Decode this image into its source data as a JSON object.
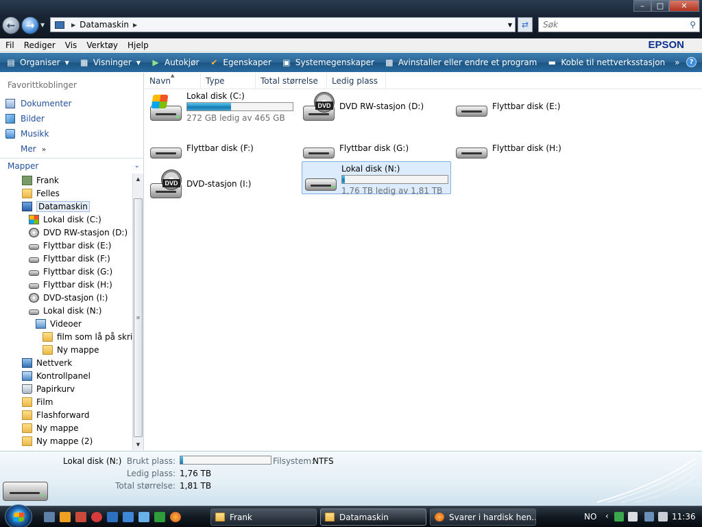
{
  "address": {
    "crumb": "Datamaskin"
  },
  "search": {
    "placeholder": "Søk"
  },
  "menu": {
    "items": [
      "Fil",
      "Rediger",
      "Vis",
      "Verktøy",
      "Hjelp"
    ],
    "brand": "EPSON"
  },
  "commands": {
    "organize": "Organiser",
    "views": "Visninger",
    "autoplay": "Autokjør",
    "properties": "Egenskaper",
    "system_properties": "Systemegenskaper",
    "uninstall": "Avinstaller eller endre et program",
    "map_drive": "Koble til nettverksstasjon",
    "more": "»"
  },
  "favorites": {
    "heading": "Favorittkoblinger",
    "items": [
      "Dokumenter",
      "Bilder",
      "Musikk"
    ],
    "more": "Mer"
  },
  "folders": {
    "heading": "Mapper",
    "tree": [
      {
        "label": "Frank",
        "icon": "user-icon"
      },
      {
        "label": "Felles",
        "icon": "folder-icon"
      },
      {
        "label": "Datamaskin",
        "icon": "computer-icon"
      },
      {
        "label": "Lokal disk (C:)",
        "icon": "windows-drive-icon"
      },
      {
        "label": "DVD RW-stasjon (D:)",
        "icon": "dvd-drive-icon"
      },
      {
        "label": "Flyttbar disk (E:)",
        "icon": "removable-drive-icon"
      },
      {
        "label": "Flyttbar disk (F:)",
        "icon": "removable-drive-icon"
      },
      {
        "label": "Flyttbar disk (G:)",
        "icon": "removable-drive-icon"
      },
      {
        "label": "Flyttbar disk (H:)",
        "icon": "removable-drive-icon"
      },
      {
        "label": "DVD-stasjon (I:)",
        "icon": "dvd-drive-icon"
      },
      {
        "label": "Lokal disk (N:)",
        "icon": "hard-drive-icon"
      },
      {
        "label": "Videoer",
        "icon": "video-folder-icon"
      },
      {
        "label": "film som lå på skrivebordet",
        "icon": "folder-icon"
      },
      {
        "label": "Ny mappe",
        "icon": "folder-icon"
      },
      {
        "label": "Nettverk",
        "icon": "network-icon"
      },
      {
        "label": "Kontrollpanel",
        "icon": "control-panel-icon"
      },
      {
        "label": "Papirkurv",
        "icon": "recycle-bin-icon"
      },
      {
        "label": "Film",
        "icon": "folder-icon"
      },
      {
        "label": "Flashforward",
        "icon": "folder-icon"
      },
      {
        "label": "Ny mappe",
        "icon": "folder-icon"
      },
      {
        "label": "Ny mappe (2)",
        "icon": "folder-icon"
      }
    ]
  },
  "columns": [
    "Navn",
    "Type",
    "Total størrelse",
    "Ledig plass"
  ],
  "drives": [
    {
      "name": "Lokal disk (C:)",
      "kind": "windows",
      "free_text": "272 GB ledig av 465 GB",
      "used_fraction": 0.415
    },
    {
      "name": "DVD RW-stasjon (D:)",
      "kind": "dvd"
    },
    {
      "name": "Flyttbar disk (E:)",
      "kind": "removable"
    },
    {
      "name": "Flyttbar disk (F:)",
      "kind": "removable"
    },
    {
      "name": "Flyttbar disk (G:)",
      "kind": "removable"
    },
    {
      "name": "Flyttbar disk (H:)",
      "kind": "removable"
    },
    {
      "name": "DVD-stasjon (I:)",
      "kind": "dvd"
    },
    {
      "name": "Lokal disk (N:)",
      "kind": "hdd",
      "free_text": "1,76 TB ledig av 1,81 TB",
      "used_fraction": 0.028,
      "selected": true
    }
  ],
  "details": {
    "name": "Lokal disk (N:)",
    "used_label": "Brukt plass:",
    "used_fraction": 0.028,
    "fs_label": "Filsystem:",
    "fs_value": "NTFS",
    "free_label": "Ledig plass:",
    "free_value": "1,76 TB",
    "total_label": "Total størrelse:",
    "total_value": "1,81 TB"
  },
  "taskbar": {
    "buttons": [
      {
        "label": "Frank",
        "icon": "folder-icon"
      },
      {
        "label": "Datamaskin",
        "icon": "folder-icon",
        "active": true
      },
      {
        "label": "Svarer i hardisk hen...",
        "icon": "firefox-icon"
      }
    ],
    "lang": "NO",
    "clock": "11:36"
  }
}
